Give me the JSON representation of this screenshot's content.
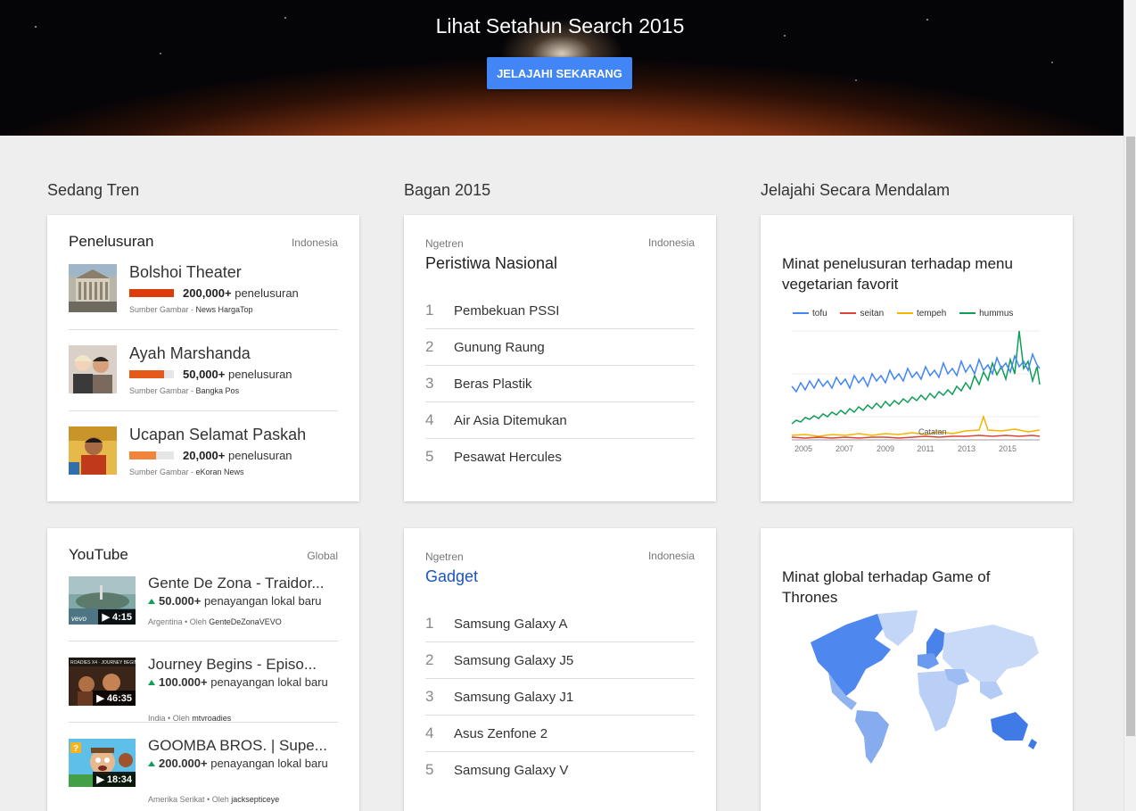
{
  "hero": {
    "title": "Lihat Setahun Search 2015",
    "button": "JELAJAHI SEKARANG"
  },
  "sections": {
    "trending": "Sedang Tren",
    "charts": "Bagan 2015",
    "explore": "Jelajahi Secara Mendalam"
  },
  "searches": {
    "title": "Penelusuran",
    "region": "Indonesia",
    "items": [
      {
        "title": "Bolshoi Theater",
        "count": "200,000+",
        "unit": "penelusuran",
        "bar_fraction": 1.0,
        "bar_color": "#dd3b0c",
        "src_label": "Sumber Gambar - ",
        "src": "News HargaTop"
      },
      {
        "title": "Ayah Marshanda",
        "count": "50,000+",
        "unit": "penelusuran",
        "bar_fraction": 0.78,
        "bar_color": "#e55a1b",
        "src_label": "Sumber Gambar - ",
        "src": "Bangka Pos"
      },
      {
        "title": "Ucapan Selamat Paskah",
        "count": "20,000+",
        "unit": "penelusuran",
        "bar_fraction": 0.6,
        "bar_color": "#f0843b",
        "src_label": "Sumber Gambar - ",
        "src": "eKoran News"
      }
    ]
  },
  "national": {
    "label": "Ngetren",
    "region": "Indonesia",
    "title": "Peristiwa Nasional",
    "items": [
      {
        "rank": "1",
        "name": "Pembekuan PSSI"
      },
      {
        "rank": "2",
        "name": "Gunung Raung"
      },
      {
        "rank": "3",
        "name": "Beras Plastik"
      },
      {
        "rank": "4",
        "name": "Air Asia Ditemukan"
      },
      {
        "rank": "5",
        "name": "Pesawat Hercules"
      }
    ]
  },
  "explore1": {
    "title": "Minat penelusuran terhadap menu vegetarian favorit",
    "legend": [
      {
        "name": "tofu",
        "color": "#4285f4"
      },
      {
        "name": "seitan",
        "color": "#db4437"
      },
      {
        "name": "tempeh",
        "color": "#f4b400"
      },
      {
        "name": "hummus",
        "color": "#0f9d58"
      }
    ],
    "x_ticks": [
      "2005",
      "2007",
      "2009",
      "2011",
      "2013",
      "2015"
    ],
    "note": "Catatan"
  },
  "youtube": {
    "title": "YouTube",
    "region": "Global",
    "items": [
      {
        "title": "Gente De Zona - Traidor...",
        "count": "50.000+",
        "unit": "penayangan lokal baru",
        "duration": "▶ 4:15",
        "country": "Argentina",
        "by": "Oleh",
        "channel": "GenteDeZonaVEVO"
      },
      {
        "title": "Journey Begins - Episo...",
        "count": "100.000+",
        "unit": "penayangan lokal baru",
        "duration": "▶ 46:35",
        "country": "India",
        "by": "Oleh",
        "channel": "mtvroadies"
      },
      {
        "title": "GOOMBA BROS. | Supe...",
        "count": "200.000+",
        "unit": "penayangan lokal baru",
        "duration": "▶ 18:34",
        "country": "Amerika Serikat",
        "by": "Oleh",
        "channel": "jacksepticeye"
      }
    ]
  },
  "gadget": {
    "label": "Ngetren",
    "region": "Indonesia",
    "title": "Gadget",
    "items": [
      {
        "rank": "1",
        "name": "Samsung Galaxy A"
      },
      {
        "rank": "2",
        "name": "Samsung Galaxy J5"
      },
      {
        "rank": "3",
        "name": "Samsung Galaxy J1"
      },
      {
        "rank": "4",
        "name": "Asus Zenfone 2"
      },
      {
        "rank": "5",
        "name": "Samsung Galaxy V"
      }
    ]
  },
  "explore2": {
    "title": "Minat global terhadap Game of Thrones"
  },
  "colors": {
    "accent": "#4285f4",
    "link": "#1a56b8"
  }
}
